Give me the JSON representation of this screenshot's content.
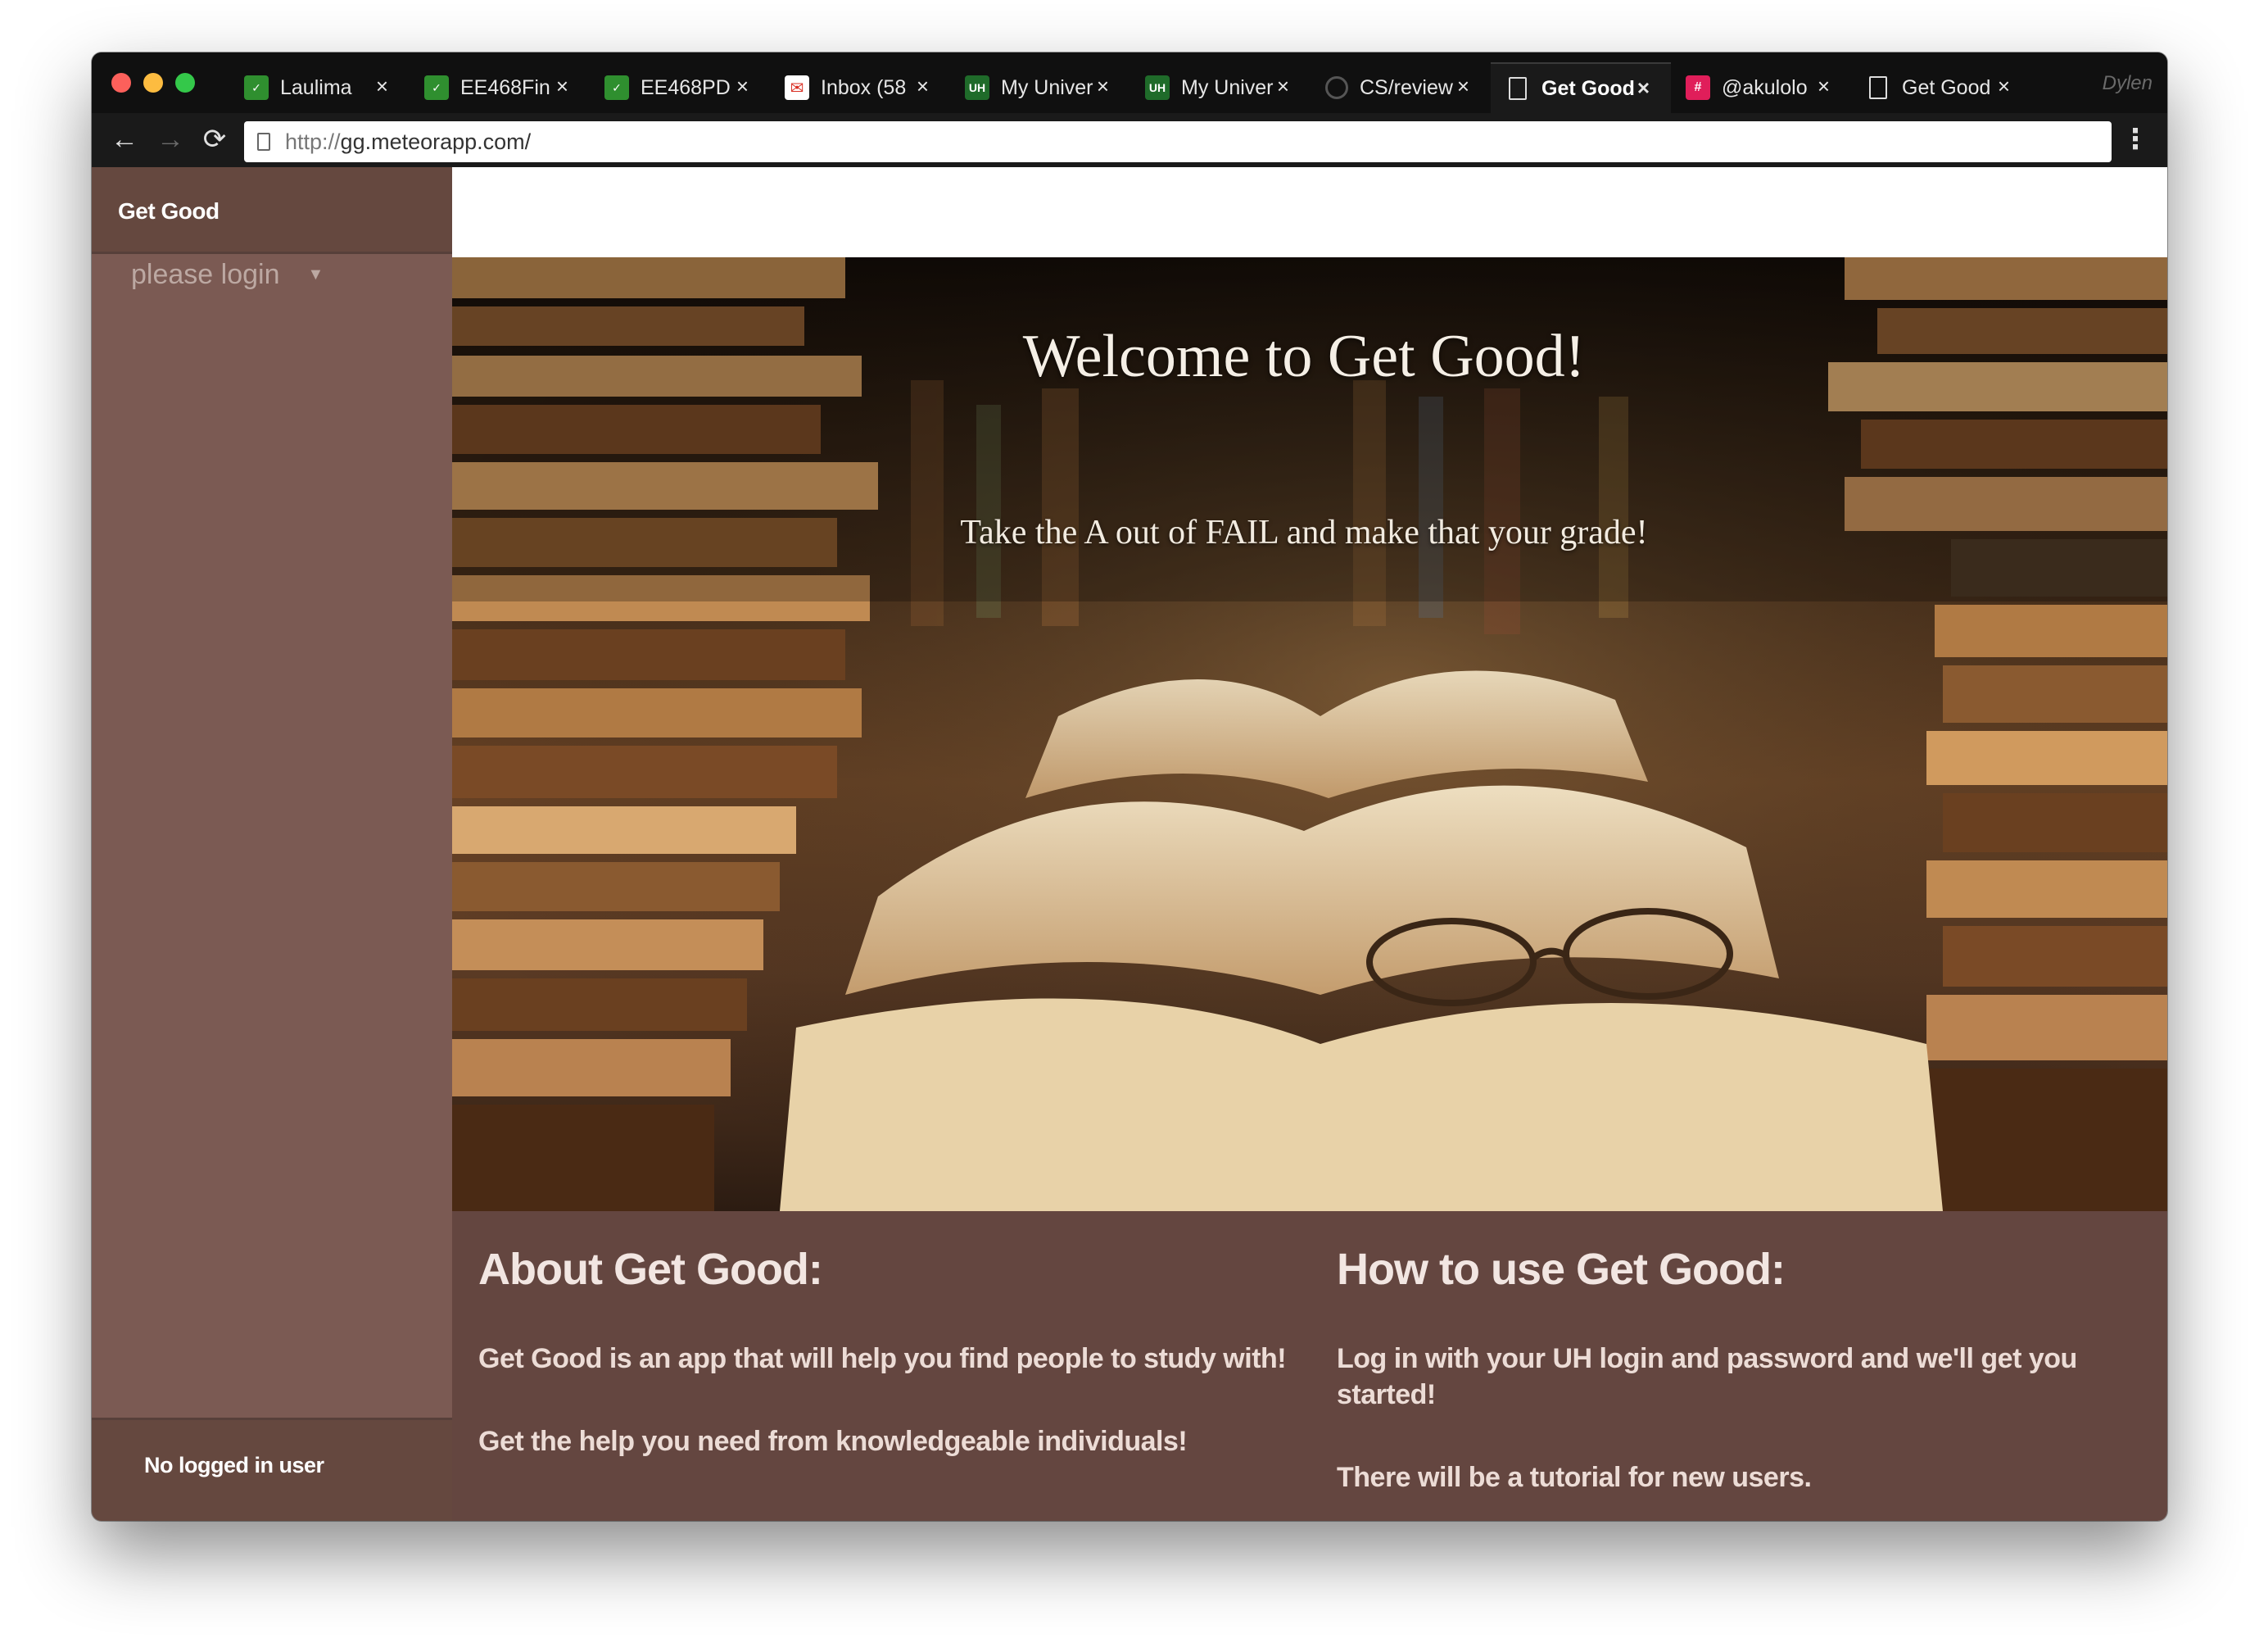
{
  "browser": {
    "tabs": [
      {
        "label": "Laulima",
        "icon": "leaf-icon"
      },
      {
        "label": "EE468Fin",
        "icon": "leaf-icon"
      },
      {
        "label": "EE468PD",
        "icon": "leaf-icon"
      },
      {
        "label": "Inbox (58",
        "icon": "gmail-icon"
      },
      {
        "label": "My Univer",
        "icon": "uh-icon"
      },
      {
        "label": "My Univer",
        "icon": "uh-icon"
      },
      {
        "label": "CS/review",
        "icon": "github-icon"
      },
      {
        "label": "Get Good",
        "icon": "page-icon",
        "active": true
      },
      {
        "label": "@akulolo",
        "icon": "slack-icon"
      },
      {
        "label": "Get Good",
        "icon": "page-icon"
      }
    ],
    "profile_name": "Dylen",
    "url_scheme": "http://",
    "url_host": "gg.meteorapp.com/"
  },
  "sidebar": {
    "brand": "Get Good",
    "login_label": "please login",
    "footer_text": "No logged in user"
  },
  "hero": {
    "title": "Welcome to Get Good!",
    "subtitle": "Take the A out of FAIL and make that your grade!"
  },
  "about": {
    "heading": "About Get Good:",
    "lines": [
      "Get Good is an app that will help you find people to study with!",
      "Get the help you need from knowledgeable individuals!"
    ]
  },
  "howto": {
    "heading": "How to use Get Good:",
    "lines": [
      "Log in with your UH login and password and we'll get you started!",
      "There will be a tutorial for new users."
    ]
  },
  "colors": {
    "sidebar": "#7b5a53",
    "sidebar_header": "#65483f",
    "info_panel": "#644640"
  }
}
